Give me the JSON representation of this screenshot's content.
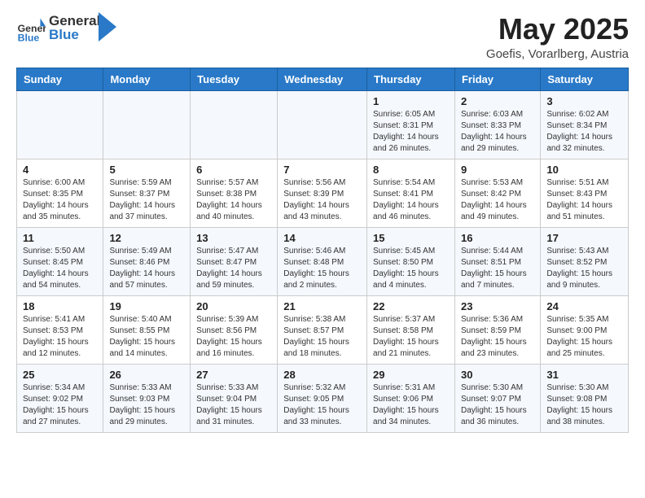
{
  "header": {
    "logo_general": "General",
    "logo_blue": "Blue",
    "month_title": "May 2025",
    "location": "Goefis, Vorarlberg, Austria"
  },
  "weekdays": [
    "Sunday",
    "Monday",
    "Tuesday",
    "Wednesday",
    "Thursday",
    "Friday",
    "Saturday"
  ],
  "weeks": [
    [
      {
        "day": "",
        "info": ""
      },
      {
        "day": "",
        "info": ""
      },
      {
        "day": "",
        "info": ""
      },
      {
        "day": "",
        "info": ""
      },
      {
        "day": "1",
        "info": "Sunrise: 6:05 AM\nSunset: 8:31 PM\nDaylight: 14 hours\nand 26 minutes."
      },
      {
        "day": "2",
        "info": "Sunrise: 6:03 AM\nSunset: 8:33 PM\nDaylight: 14 hours\nand 29 minutes."
      },
      {
        "day": "3",
        "info": "Sunrise: 6:02 AM\nSunset: 8:34 PM\nDaylight: 14 hours\nand 32 minutes."
      }
    ],
    [
      {
        "day": "4",
        "info": "Sunrise: 6:00 AM\nSunset: 8:35 PM\nDaylight: 14 hours\nand 35 minutes."
      },
      {
        "day": "5",
        "info": "Sunrise: 5:59 AM\nSunset: 8:37 PM\nDaylight: 14 hours\nand 37 minutes."
      },
      {
        "day": "6",
        "info": "Sunrise: 5:57 AM\nSunset: 8:38 PM\nDaylight: 14 hours\nand 40 minutes."
      },
      {
        "day": "7",
        "info": "Sunrise: 5:56 AM\nSunset: 8:39 PM\nDaylight: 14 hours\nand 43 minutes."
      },
      {
        "day": "8",
        "info": "Sunrise: 5:54 AM\nSunset: 8:41 PM\nDaylight: 14 hours\nand 46 minutes."
      },
      {
        "day": "9",
        "info": "Sunrise: 5:53 AM\nSunset: 8:42 PM\nDaylight: 14 hours\nand 49 minutes."
      },
      {
        "day": "10",
        "info": "Sunrise: 5:51 AM\nSunset: 8:43 PM\nDaylight: 14 hours\nand 51 minutes."
      }
    ],
    [
      {
        "day": "11",
        "info": "Sunrise: 5:50 AM\nSunset: 8:45 PM\nDaylight: 14 hours\nand 54 minutes."
      },
      {
        "day": "12",
        "info": "Sunrise: 5:49 AM\nSunset: 8:46 PM\nDaylight: 14 hours\nand 57 minutes."
      },
      {
        "day": "13",
        "info": "Sunrise: 5:47 AM\nSunset: 8:47 PM\nDaylight: 14 hours\nand 59 minutes."
      },
      {
        "day": "14",
        "info": "Sunrise: 5:46 AM\nSunset: 8:48 PM\nDaylight: 15 hours\nand 2 minutes."
      },
      {
        "day": "15",
        "info": "Sunrise: 5:45 AM\nSunset: 8:50 PM\nDaylight: 15 hours\nand 4 minutes."
      },
      {
        "day": "16",
        "info": "Sunrise: 5:44 AM\nSunset: 8:51 PM\nDaylight: 15 hours\nand 7 minutes."
      },
      {
        "day": "17",
        "info": "Sunrise: 5:43 AM\nSunset: 8:52 PM\nDaylight: 15 hours\nand 9 minutes."
      }
    ],
    [
      {
        "day": "18",
        "info": "Sunrise: 5:41 AM\nSunset: 8:53 PM\nDaylight: 15 hours\nand 12 minutes."
      },
      {
        "day": "19",
        "info": "Sunrise: 5:40 AM\nSunset: 8:55 PM\nDaylight: 15 hours\nand 14 minutes."
      },
      {
        "day": "20",
        "info": "Sunrise: 5:39 AM\nSunset: 8:56 PM\nDaylight: 15 hours\nand 16 minutes."
      },
      {
        "day": "21",
        "info": "Sunrise: 5:38 AM\nSunset: 8:57 PM\nDaylight: 15 hours\nand 18 minutes."
      },
      {
        "day": "22",
        "info": "Sunrise: 5:37 AM\nSunset: 8:58 PM\nDaylight: 15 hours\nand 21 minutes."
      },
      {
        "day": "23",
        "info": "Sunrise: 5:36 AM\nSunset: 8:59 PM\nDaylight: 15 hours\nand 23 minutes."
      },
      {
        "day": "24",
        "info": "Sunrise: 5:35 AM\nSunset: 9:00 PM\nDaylight: 15 hours\nand 25 minutes."
      }
    ],
    [
      {
        "day": "25",
        "info": "Sunrise: 5:34 AM\nSunset: 9:02 PM\nDaylight: 15 hours\nand 27 minutes."
      },
      {
        "day": "26",
        "info": "Sunrise: 5:33 AM\nSunset: 9:03 PM\nDaylight: 15 hours\nand 29 minutes."
      },
      {
        "day": "27",
        "info": "Sunrise: 5:33 AM\nSunset: 9:04 PM\nDaylight: 15 hours\nand 31 minutes."
      },
      {
        "day": "28",
        "info": "Sunrise: 5:32 AM\nSunset: 9:05 PM\nDaylight: 15 hours\nand 33 minutes."
      },
      {
        "day": "29",
        "info": "Sunrise: 5:31 AM\nSunset: 9:06 PM\nDaylight: 15 hours\nand 34 minutes."
      },
      {
        "day": "30",
        "info": "Sunrise: 5:30 AM\nSunset: 9:07 PM\nDaylight: 15 hours\nand 36 minutes."
      },
      {
        "day": "31",
        "info": "Sunrise: 5:30 AM\nSunset: 9:08 PM\nDaylight: 15 hours\nand 38 minutes."
      }
    ]
  ]
}
